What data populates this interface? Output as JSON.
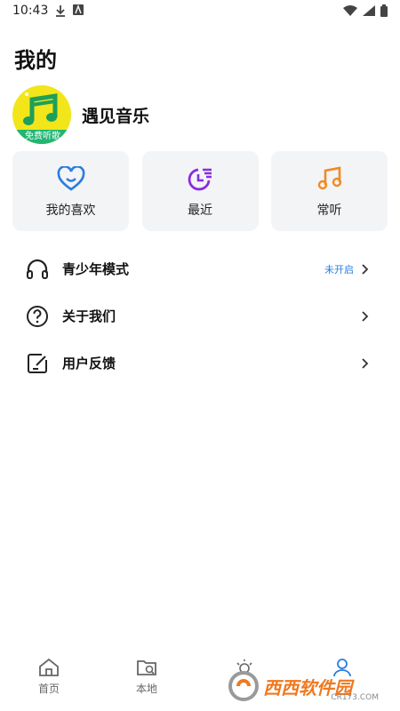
{
  "status_bar": {
    "time": "10:43"
  },
  "page_title": "我的",
  "profile": {
    "name": "遇见音乐",
    "avatar_badge": "免费听歌"
  },
  "shortcuts": [
    {
      "label": "我的喜欢",
      "icon": "heart-icon",
      "color": "#2a7de1"
    },
    {
      "label": "最近",
      "icon": "recent-icon",
      "color": "#8a2be2"
    },
    {
      "label": "常听",
      "icon": "music-note-icon",
      "color": "#f08a24"
    }
  ],
  "menu": [
    {
      "label": "青少年模式",
      "status": "未开启",
      "icon": "headphones-icon"
    },
    {
      "label": "关于我们",
      "status": "",
      "icon": "question-icon"
    },
    {
      "label": "用户反馈",
      "status": "",
      "icon": "feedback-icon"
    }
  ],
  "bottom_nav": [
    {
      "label": "首页",
      "icon": "home-icon"
    },
    {
      "label": "本地",
      "icon": "local-folder-icon"
    },
    {
      "label": "",
      "icon": "discover-icon"
    },
    {
      "label": "",
      "icon": "profile-icon"
    }
  ],
  "watermark": {
    "main": "西西软件园",
    "sub": "CR173.COM"
  },
  "colors": {
    "accent_blue": "#2a7de1",
    "avatar_yellow": "#f2e61a",
    "badge_green": "#22b573"
  }
}
